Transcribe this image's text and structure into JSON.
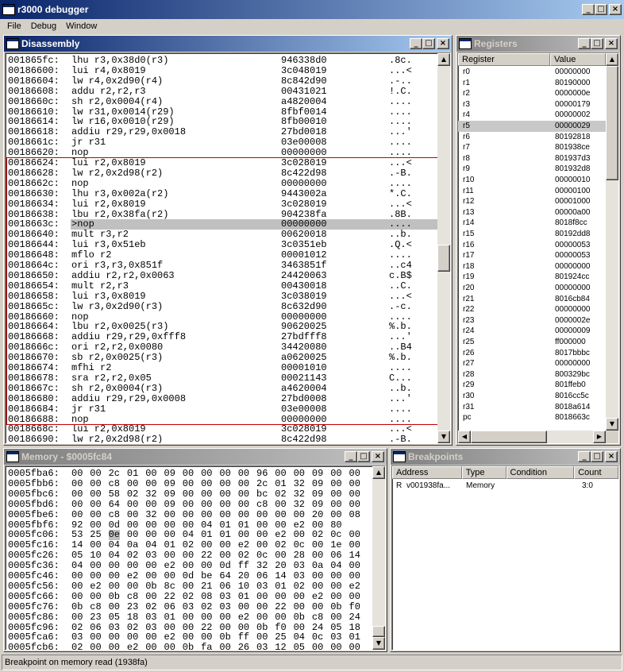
{
  "app": {
    "title": "r3000 debugger"
  },
  "menu": [
    "File",
    "Debug",
    "Window"
  ],
  "disassembly": {
    "title": "Disassembly",
    "rows": [
      {
        "addr": "001865fc:",
        "instr": "lhu r3,0x38d0(r3)",
        "hex": "946338d0",
        "ascii": ".8c."
      },
      {
        "addr": "00186600:",
        "instr": "lui r4,0x8019",
        "hex": "3c048019",
        "ascii": "...<"
      },
      {
        "addr": "00186604:",
        "instr": "lw r4,0x2d90(r4)",
        "hex": "8c842d90",
        "ascii": ".-.."
      },
      {
        "addr": "00186608:",
        "instr": "addu r2,r2,r3",
        "hex": "00431021",
        "ascii": "!.C."
      },
      {
        "addr": "0018660c:",
        "instr": "sh r2,0x0004(r4)",
        "hex": "a4820004",
        "ascii": "...."
      },
      {
        "addr": "00186610:",
        "instr": "lw r31,0x0014(r29)",
        "hex": "8fbf0014",
        "ascii": "...."
      },
      {
        "addr": "00186614:",
        "instr": "lw r16,0x0010(r29)",
        "hex": "8fb00010",
        "ascii": "...."
      },
      {
        "addr": "00186618:",
        "instr": "addiu r29,r29,0x0018",
        "hex": "27bd0018",
        "ascii": "...'"
      },
      {
        "addr": "0018661c:",
        "instr": "jr r31",
        "hex": "03e00008",
        "ascii": "...."
      },
      {
        "addr": "00186620:",
        "instr": "nop",
        "hex": "00000000",
        "ascii": "...."
      },
      {
        "addr": "00186624:",
        "instr": "lui r2,0x8019",
        "hex": "3c028019",
        "ascii": "...<"
      },
      {
        "addr": "00186628:",
        "instr": "lw r2,0x2d98(r2)",
        "hex": "8c422d98",
        "ascii": ".-B."
      },
      {
        "addr": "0018662c:",
        "instr": "nop",
        "hex": "00000000",
        "ascii": "...."
      },
      {
        "addr": "00186630:",
        "instr": "lhu r3,0x002a(r2)",
        "hex": "9443002a",
        "ascii": "*.C."
      },
      {
        "addr": "00186634:",
        "instr": "lui r2,0x8019",
        "hex": "3c028019",
        "ascii": "...<"
      },
      {
        "addr": "00186638:",
        "instr": "lbu r2,0x38fa(r2)",
        "hex": "904238fa",
        "ascii": ".8B."
      },
      {
        "addr": "0018663c:",
        "instr": ">nop",
        "hex": "00000000",
        "ascii": "...."
      },
      {
        "addr": "00186640:",
        "instr": "mult r3,r2",
        "hex": "00620018",
        "ascii": "..b."
      },
      {
        "addr": "00186644:",
        "instr": "lui r3,0x51eb",
        "hex": "3c0351eb",
        "ascii": ".Q.<"
      },
      {
        "addr": "00186648:",
        "instr": "mflo r2",
        "hex": "00001012",
        "ascii": "...."
      },
      {
        "addr": "0018664c:",
        "instr": "ori r3,r3,0x851f",
        "hex": "3463851f",
        "ascii": "..c4"
      },
      {
        "addr": "00186650:",
        "instr": "addiu r2,r2,0x0063",
        "hex": "24420063",
        "ascii": "c.B$"
      },
      {
        "addr": "00186654:",
        "instr": "mult r2,r3",
        "hex": "00430018",
        "ascii": "..C."
      },
      {
        "addr": "00186658:",
        "instr": "lui r3,0x8019",
        "hex": "3c038019",
        "ascii": "...<"
      },
      {
        "addr": "0018665c:",
        "instr": "lw r3,0x2d90(r3)",
        "hex": "8c632d90",
        "ascii": ".-c."
      },
      {
        "addr": "00186660:",
        "instr": "nop",
        "hex": "00000000",
        "ascii": "...."
      },
      {
        "addr": "00186664:",
        "instr": "lbu r2,0x0025(r3)",
        "hex": "90620025",
        "ascii": "%.b."
      },
      {
        "addr": "00186668:",
        "instr": "addiu r29,r29,0xfff8",
        "hex": "27bdfff8",
        "ascii": "...'"
      },
      {
        "addr": "0018666c:",
        "instr": "ori r2,r2,0x0080",
        "hex": "34420080",
        "ascii": "..B4"
      },
      {
        "addr": "00186670:",
        "instr": "sb r2,0x0025(r3)",
        "hex": "a0620025",
        "ascii": "%.b."
      },
      {
        "addr": "00186674:",
        "instr": "mfhi r2",
        "hex": "00001010",
        "ascii": "...."
      },
      {
        "addr": "00186678:",
        "instr": "sra r2,r2,0x05",
        "hex": "00021143",
        "ascii": "C..."
      },
      {
        "addr": "0018667c:",
        "instr": "sh r2,0x0004(r3)",
        "hex": "a4620004",
        "ascii": "..b."
      },
      {
        "addr": "00186680:",
        "instr": "addiu r29,r29,0x0008",
        "hex": "27bd0008",
        "ascii": "...'"
      },
      {
        "addr": "00186684:",
        "instr": "jr r31",
        "hex": "03e00008",
        "ascii": "...."
      },
      {
        "addr": "00186688:",
        "instr": "nop",
        "hex": "00000000",
        "ascii": "...."
      },
      {
        "addr": "0018668c:",
        "instr": "lui r2,0x8019",
        "hex": "3c028019",
        "ascii": "...<"
      },
      {
        "addr": "00186690:",
        "instr": "lw r2,0x2d98(r2)",
        "hex": "8c422d98",
        "ascii": ".-B."
      }
    ]
  },
  "registers": {
    "title": "Registers",
    "columns": [
      "Register",
      "Value"
    ],
    "rows": [
      [
        "r0",
        "00000000"
      ],
      [
        "r1",
        "80190000"
      ],
      [
        "r2",
        "0000000e"
      ],
      [
        "r3",
        "00000179"
      ],
      [
        "r4",
        "00000002"
      ],
      [
        "r5",
        "00000029"
      ],
      [
        "r6",
        "80192818"
      ],
      [
        "r7",
        "801938ce"
      ],
      [
        "r8",
        "801937d3"
      ],
      [
        "r9",
        "801932d8"
      ],
      [
        "r10",
        "00000010"
      ],
      [
        "r11",
        "00000100"
      ],
      [
        "r12",
        "00001000"
      ],
      [
        "r13",
        "00000a00"
      ],
      [
        "r14",
        "8018f8cc"
      ],
      [
        "r15",
        "80192dd8"
      ],
      [
        "r16",
        "00000053"
      ],
      [
        "r17",
        "00000053"
      ],
      [
        "r18",
        "00000000"
      ],
      [
        "r19",
        "801924cc"
      ],
      [
        "r20",
        "00000000"
      ],
      [
        "r21",
        "8016cb84"
      ],
      [
        "r22",
        "00000000"
      ],
      [
        "r23",
        "0000002e"
      ],
      [
        "r24",
        "00000009"
      ],
      [
        "r25",
        "ff000000"
      ],
      [
        "r26",
        "8017bbbc"
      ],
      [
        "r27",
        "00000000"
      ],
      [
        "r28",
        "800329bc"
      ],
      [
        "r29",
        "801ffeb0"
      ],
      [
        "r30",
        "8016cc5c"
      ],
      [
        "r31",
        "8018a614"
      ],
      [
        "pc",
        "8018663c"
      ]
    ]
  },
  "memory": {
    "title": "Memory - $0005fc84",
    "rows": [
      {
        "addr": "0005fba6:",
        "bytes": [
          "00",
          "00",
          "2c",
          "01",
          "00",
          "09",
          "00",
          "00",
          "00",
          "00",
          "96",
          "00",
          "00",
          "09",
          "00",
          "00"
        ]
      },
      {
        "addr": "0005fbb6:",
        "bytes": [
          "00",
          "00",
          "c8",
          "00",
          "00",
          "09",
          "00",
          "00",
          "00",
          "00",
          "2c",
          "01",
          "32",
          "09",
          "00",
          "00"
        ]
      },
      {
        "addr": "0005fbc6:",
        "bytes": [
          "00",
          "00",
          "58",
          "02",
          "32",
          "09",
          "00",
          "00",
          "00",
          "00",
          "bc",
          "02",
          "32",
          "09",
          "00",
          "00"
        ]
      },
      {
        "addr": "0005fbd6:",
        "bytes": [
          "00",
          "00",
          "64",
          "00",
          "00",
          "09",
          "00",
          "00",
          "00",
          "00",
          "c8",
          "00",
          "32",
          "09",
          "00",
          "00"
        ]
      },
      {
        "addr": "0005fbe6:",
        "bytes": [
          "00",
          "00",
          "c8",
          "00",
          "32",
          "00",
          "00",
          "00",
          "00",
          "00",
          "00",
          "00",
          "00",
          "20",
          "00",
          "08"
        ]
      },
      {
        "addr": "0005fbf6:",
        "bytes": [
          "92",
          "00",
          "0d",
          "00",
          "00",
          "00",
          "00",
          "04",
          "01",
          "01",
          "00",
          "00",
          "e2",
          "00",
          "80"
        ]
      },
      {
        "addr": "0005fc06:",
        "bytes": [
          "53",
          "25",
          "0e",
          "00",
          "00",
          "00",
          "04",
          "01",
          "01",
          "00",
          "00",
          "e2",
          "00",
          "02",
          "0c",
          "00"
        ]
      },
      {
        "addr": "0005fc16:",
        "bytes": [
          "14",
          "00",
          "04",
          "0a",
          "04",
          "01",
          "02",
          "00",
          "00",
          "e2",
          "00",
          "02",
          "0c",
          "00",
          "1e",
          "00"
        ]
      },
      {
        "addr": "0005fc26:",
        "bytes": [
          "05",
          "10",
          "04",
          "02",
          "03",
          "00",
          "00",
          "22",
          "00",
          "02",
          "0c",
          "00",
          "28",
          "00",
          "06",
          "14"
        ]
      },
      {
        "addr": "0005fc36:",
        "bytes": [
          "04",
          "00",
          "00",
          "00",
          "00",
          "e2",
          "00",
          "00",
          "0d",
          "ff",
          "32",
          "20",
          "03",
          "0a",
          "04",
          "00"
        ]
      },
      {
        "addr": "0005fc46:",
        "bytes": [
          "00",
          "00",
          "00",
          "e2",
          "00",
          "00",
          "0d",
          "be",
          "64",
          "20",
          "06",
          "14",
          "03",
          "00",
          "00",
          "00"
        ]
      },
      {
        "addr": "0005fc56:",
        "bytes": [
          "00",
          "e2",
          "00",
          "00",
          "0b",
          "8c",
          "00",
          "21",
          "06",
          "10",
          "03",
          "01",
          "02",
          "00",
          "00",
          "e2"
        ]
      },
      {
        "addr": "0005fc66:",
        "bytes": [
          "00",
          "00",
          "0b",
          "c8",
          "00",
          "22",
          "02",
          "08",
          "03",
          "01",
          "00",
          "00",
          "00",
          "e2",
          "00",
          "00"
        ]
      },
      {
        "addr": "0005fc76:",
        "bytes": [
          "0b",
          "c8",
          "00",
          "23",
          "02",
          "06",
          "03",
          "02",
          "03",
          "00",
          "00",
          "22",
          "00",
          "00",
          "0b",
          "f0"
        ]
      },
      {
        "addr": "0005fc86:",
        "bytes": [
          "00",
          "23",
          "05",
          "18",
          "03",
          "01",
          "00",
          "00",
          "00",
          "e2",
          "00",
          "00",
          "0b",
          "c8",
          "00",
          "24"
        ]
      },
      {
        "addr": "0005fc96:",
        "bytes": [
          "02",
          "06",
          "03",
          "02",
          "03",
          "00",
          "00",
          "22",
          "00",
          "00",
          "0b",
          "f0",
          "00",
          "24",
          "05",
          "18"
        ]
      },
      {
        "addr": "0005fca6:",
        "bytes": [
          "03",
          "00",
          "00",
          "00",
          "00",
          "e2",
          "00",
          "00",
          "0b",
          "ff",
          "00",
          "25",
          "04",
          "0c",
          "03",
          "01"
        ]
      },
      {
        "addr": "0005fcb6:",
        "bytes": [
          "02",
          "00",
          "00",
          "e2",
          "00",
          "00",
          "0b",
          "fa",
          "00",
          "26",
          "03",
          "12",
          "05",
          "00",
          "00",
          "00"
        ]
      }
    ]
  },
  "breakpoints": {
    "title": "Breakpoints",
    "columns": [
      "Address",
      "Type",
      "Condition",
      "Count"
    ],
    "rows": [
      {
        "flag": "R",
        "address": "v001938fa...",
        "type": "Memory",
        "condition": "",
        "count": "3:0"
      }
    ]
  },
  "status": {
    "text": "Breakpoint on memory read (1938fa)"
  },
  "colors": {
    "active_title": "#0a246a",
    "inactive_title": "#808080",
    "highlight": "#c0c0c0",
    "breakpoint_box": "#c00000",
    "panel": "#d4d0c8"
  }
}
